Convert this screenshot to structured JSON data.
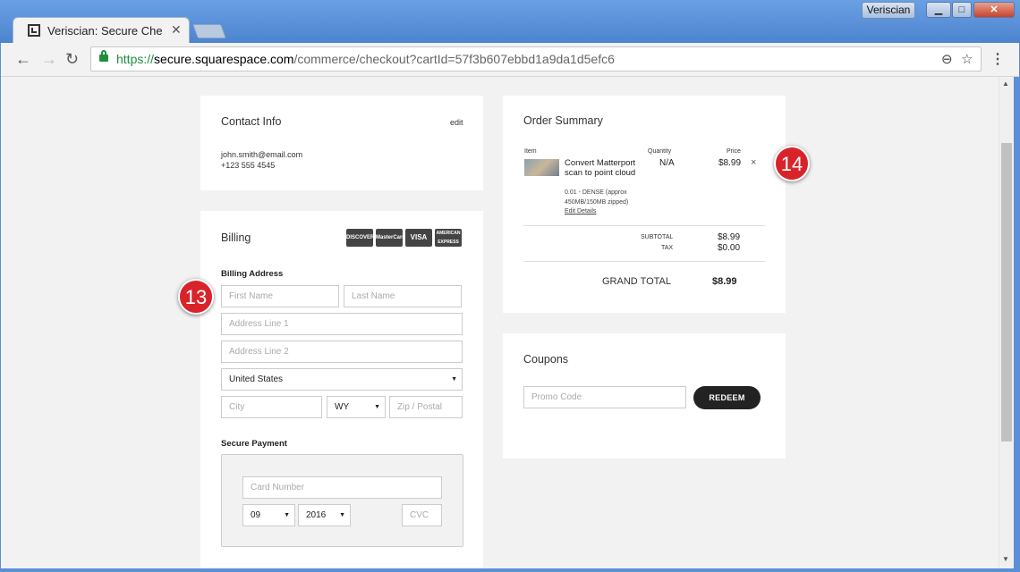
{
  "browser": {
    "tab_title": "Veriscian: Secure Checko",
    "profile_name": "Veriscian",
    "url_scheme": "https://",
    "url_host": "secure.squarespace.com",
    "url_path": "/commerce/checkout?cartId=57f3b607ebbd1a9da1d5efc6"
  },
  "contact": {
    "title": "Contact Info",
    "edit_label": "edit",
    "email": "john.smith@email.com",
    "phone": "+123 555 4545"
  },
  "billing": {
    "title": "Billing",
    "cards": [
      "DISCOVER",
      "MasterCard",
      "VISA",
      "AMERICAN EXPRESS"
    ],
    "address_label": "Billing Address",
    "first_name_placeholder": "First Name",
    "last_name_placeholder": "Last Name",
    "address1_placeholder": "Address Line 1",
    "address2_placeholder": "Address Line 2",
    "country": "United States",
    "city_placeholder": "City",
    "state": "WY",
    "zip_placeholder": "Zip / Postal",
    "payment_label": "Secure Payment",
    "card_number_placeholder": "Card Number",
    "exp_month": "09",
    "exp_year": "2016",
    "cvc_placeholder": "CVC"
  },
  "summary": {
    "title": "Order Summary",
    "col_item": "Item",
    "col_quantity": "Quantity",
    "col_price": "Price",
    "item_name": "Convert Matterport scan to point cloud",
    "item_desc": "0.01 - DENSE (approx 450MB/150MB zipped)",
    "item_link": "Edit Details",
    "quantity": "N/A",
    "price": "$8.99",
    "remove": "×",
    "subtotal_label": "SUBTOTAL",
    "subtotal": "$8.99",
    "tax_label": "TAX",
    "tax": "$0.00",
    "grand_total_label": "GRAND TOTAL",
    "grand_total": "$8.99"
  },
  "coupons": {
    "title": "Coupons",
    "promo_placeholder": "Promo Code",
    "redeem_label": "REDEEM"
  },
  "markers": {
    "billing": "13",
    "summary": "14"
  },
  "colors": {
    "accent_dark": "#222222",
    "marker_red": "#d9232a",
    "secure_green": "#1e8e3e"
  }
}
